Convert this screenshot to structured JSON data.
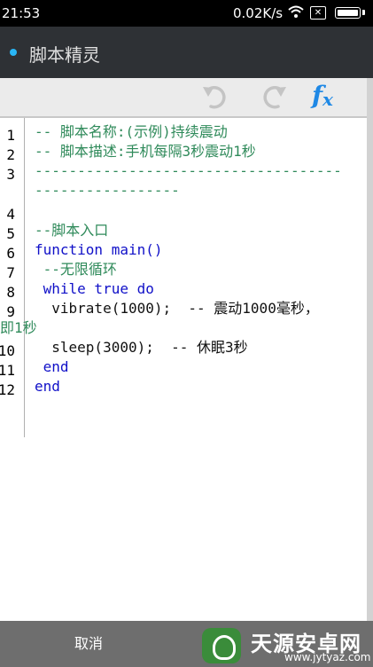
{
  "status_bar": {
    "time": "21:53",
    "speed": "0.02K/s",
    "wifi_icon": "wifi-icon",
    "sim_label": "✕",
    "battery_icon": "battery-icon"
  },
  "title_bar": {
    "title": "脚本精灵",
    "dot_color": "#29b6f6"
  },
  "toolbar": {
    "undo_icon": "undo-icon",
    "redo_icon": "redo-icon",
    "fx_label": "f",
    "fx_sub": "x"
  },
  "editor": {
    "line_numbers": [
      "1",
      "2",
      "3",
      "4",
      "5",
      "6",
      "7",
      "8",
      "9",
      "10",
      "11",
      "12"
    ],
    "lines": [
      "-- 脚本名称:(示例)持续震动",
      "-- 脚本描述:手机每隔3秒震动1秒",
      "------------------------------------",
      "-----------------",
      "--脚本入口",
      "function main()",
      " --无限循环",
      " while true do",
      "  vibrate(1000);  -- 震动1000毫秒，",
      "即1秒",
      "  sleep(3000);  -- 休眠3秒",
      " end",
      "end"
    ]
  },
  "bottom": {
    "cancel_label": "取消",
    "watermark_title": "天源安卓网",
    "watermark_url": "www.jytyaz.com"
  }
}
